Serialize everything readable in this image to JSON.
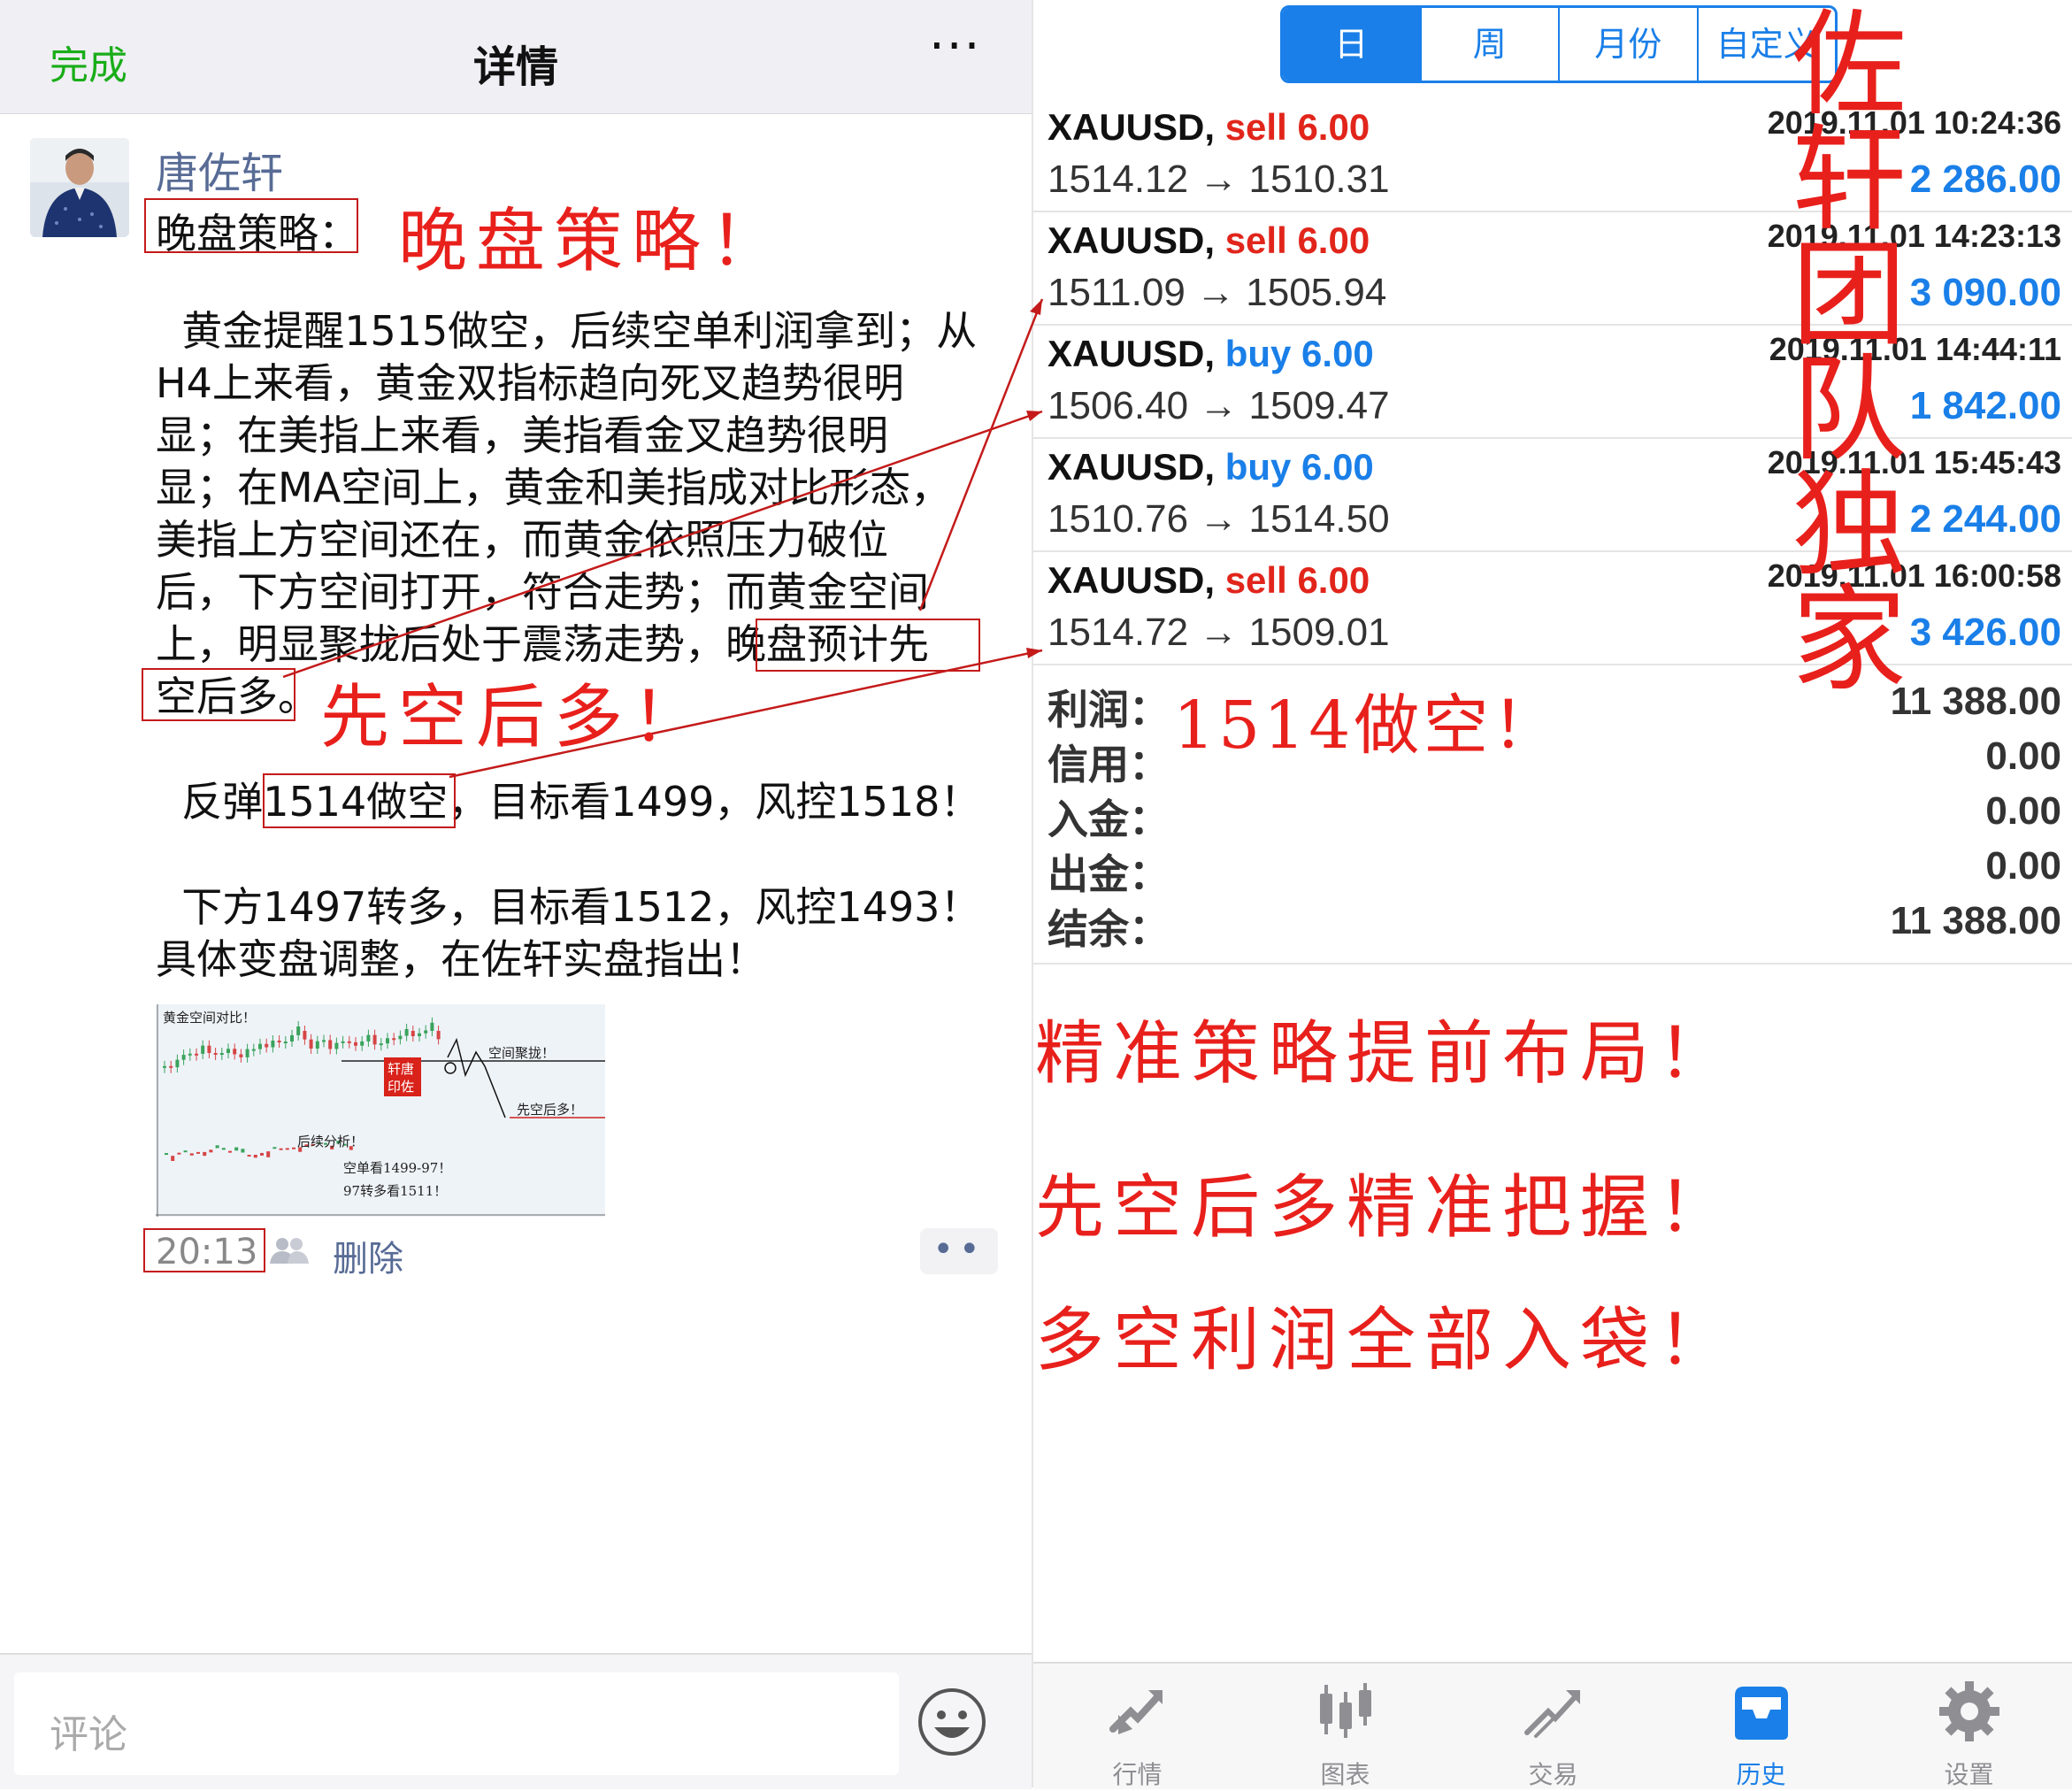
{
  "left": {
    "header": {
      "done_label": "完成",
      "title": "详情",
      "more_label": "···"
    },
    "post": {
      "author": "唐佐轩",
      "title": "晚盘策略：",
      "body_lines": [
        "  黄金提醒1515做空，后续空单利润拿到；从",
        "H4上来看，黄金双指标趋向死叉趋势很明",
        "显；在美指上来看，美指看金叉趋势很明",
        "显；在MA空间上，黄金和美指成对比形态，",
        "美指上方空间还在，而黄金依照压力破位",
        "后，下方空间打开，符合走势；而黄金空间",
        "上，明显聚拢后处于震荡走势，晚盘预计先",
        "空后多。"
      ],
      "strategy_line": "  反弹1514做空，目标看1499，风控1518！",
      "reverse_lines": [
        "  下方1497转多，目标看1512，风控1493！",
        "具体变盘调整，在佐轩实盘指出！"
      ],
      "time": "20:13",
      "delete_label": "删除",
      "chart_thumb": {
        "title": "黄金空间对比！",
        "label_converge": "空间聚拢！",
        "label_short_long": "先空后多！",
        "analysis": "后续分析！",
        "plan_short": "空单看1499-97！",
        "plan_long": "97转多看1511！",
        "stamp": "轩唐印佐"
      }
    },
    "footer": {
      "comment_placeholder": "评论"
    }
  },
  "right": {
    "segments": [
      "日",
      "周",
      "月份",
      "自定义"
    ],
    "active_segment": "日",
    "trades": [
      {
        "symbol": "XAUUSD,",
        "side": "sell",
        "volume": "6.00",
        "datetime": "2019.11.01 10:24:36",
        "open": "1514.12",
        "close": "1510.31",
        "arrow": "→",
        "profit": "2 286.00"
      },
      {
        "symbol": "XAUUSD,",
        "side": "sell",
        "volume": "6.00",
        "datetime": "2019.11.01 14:23:13",
        "open": "1511.09",
        "close": "1505.94",
        "arrow": "→",
        "profit": "3 090.00"
      },
      {
        "symbol": "XAUUSD,",
        "side": "buy",
        "volume": "6.00",
        "datetime": "2019.11.01 14:44:11",
        "open": "1506.40",
        "close": "1509.47",
        "arrow": "→",
        "profit": "1 842.00"
      },
      {
        "symbol": "XAUUSD,",
        "side": "buy",
        "volume": "6.00",
        "datetime": "2019.11.01 15:45:43",
        "open": "1510.76",
        "close": "1514.50",
        "arrow": "→",
        "profit": "2 244.00"
      },
      {
        "symbol": "XAUUSD,",
        "side": "sell",
        "volume": "6.00",
        "datetime": "2019.11.01 16:00:58",
        "open": "1514.72",
        "close": "1509.01",
        "arrow": "→",
        "profit": "3 426.00"
      }
    ],
    "summary": [
      {
        "label": "利润：",
        "value": "11 388.00"
      },
      {
        "label": "信用：",
        "value": "0.00"
      },
      {
        "label": "入金：",
        "value": "0.00"
      },
      {
        "label": "出金：",
        "value": "0.00"
      },
      {
        "label": "结余：",
        "value": "11 388.00"
      }
    ],
    "tabs": [
      {
        "label": "行情",
        "icon": "quotes-icon"
      },
      {
        "label": "图表",
        "icon": "chart-icon"
      },
      {
        "label": "交易",
        "icon": "trade-icon"
      },
      {
        "label": "历史",
        "icon": "history-icon"
      },
      {
        "label": "设置",
        "icon": "settings-icon"
      }
    ],
    "active_tab": "历史"
  },
  "annotations": {
    "evening": "晚盘策略！",
    "short_then_long": "先空后多！",
    "short_1514": "1514做空！",
    "slogan_1": "精准策略提前布局！",
    "slogan_2": "先空后多精准把握！",
    "slogan_3": "多空利润全部入袋！",
    "team_chars": [
      "佐",
      "轩",
      "团",
      "队",
      "独",
      "家"
    ]
  },
  "colors": {
    "accent_blue": "#1a7fe8",
    "sell_red": "#e1251b",
    "wechat_green": "#1aad19",
    "link_blue": "#576b95",
    "annotation_red": "#e8201c"
  }
}
